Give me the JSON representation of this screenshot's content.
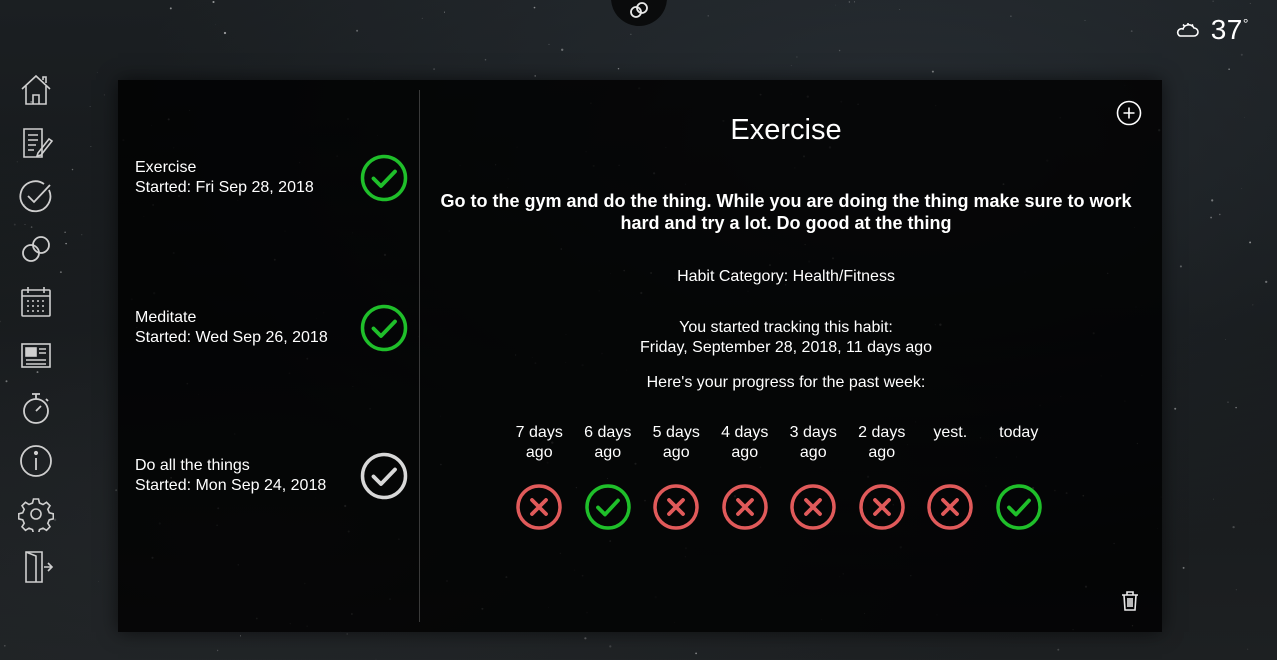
{
  "weather": {
    "icon": "partly-cloudy-icon",
    "temperature": "37",
    "unit": "°"
  },
  "sidebar": {
    "items": [
      {
        "icon": "home-icon"
      },
      {
        "icon": "notes-icon"
      },
      {
        "icon": "check-icon"
      },
      {
        "icon": "habits-link-icon"
      },
      {
        "icon": "calendar-icon"
      },
      {
        "icon": "news-icon"
      },
      {
        "icon": "timer-icon"
      },
      {
        "icon": "info-icon"
      },
      {
        "icon": "settings-icon"
      },
      {
        "icon": "logout-icon"
      }
    ]
  },
  "habits": [
    {
      "name": "Exercise",
      "started": "Started: Fri Sep 28, 2018",
      "status": "done",
      "status_color": "#1fbf2a"
    },
    {
      "name": "Meditate",
      "started": "Started: Wed Sep 26, 2018",
      "status": "done",
      "status_color": "#1fbf2a"
    },
    {
      "name": "Do all the things",
      "started": "Started: Mon Sep 24, 2018",
      "status": "pending",
      "status_color": "#d8d8d8"
    }
  ],
  "detail": {
    "title": "Exercise",
    "description": "Go to the gym and do the thing. While you are doing the thing make sure to work hard and try a lot. Do good at the thing",
    "category": "Habit Category: Health/Fitness",
    "tracking_intro": "You started tracking this habit:",
    "tracking_date": "Friday, September 28, 2018, 11 days ago",
    "progress_intro": "Here's your progress for the past week:",
    "week": [
      {
        "line1": "7 days",
        "line2": "ago",
        "done": false
      },
      {
        "line1": "6 days",
        "line2": "ago",
        "done": true
      },
      {
        "line1": "5 days",
        "line2": "ago",
        "done": false
      },
      {
        "line1": "4 days",
        "line2": "ago",
        "done": false
      },
      {
        "line1": "3 days",
        "line2": "ago",
        "done": false
      },
      {
        "line1": "2 days",
        "line2": "ago",
        "done": false
      },
      {
        "line1": "yest.",
        "line2": "",
        "done": false
      },
      {
        "line1": "today",
        "line2": "",
        "done": true
      }
    ]
  },
  "colors": {
    "success": "#1fbf2a",
    "fail": "#e05a5a",
    "icon": "#cfcfcf"
  }
}
